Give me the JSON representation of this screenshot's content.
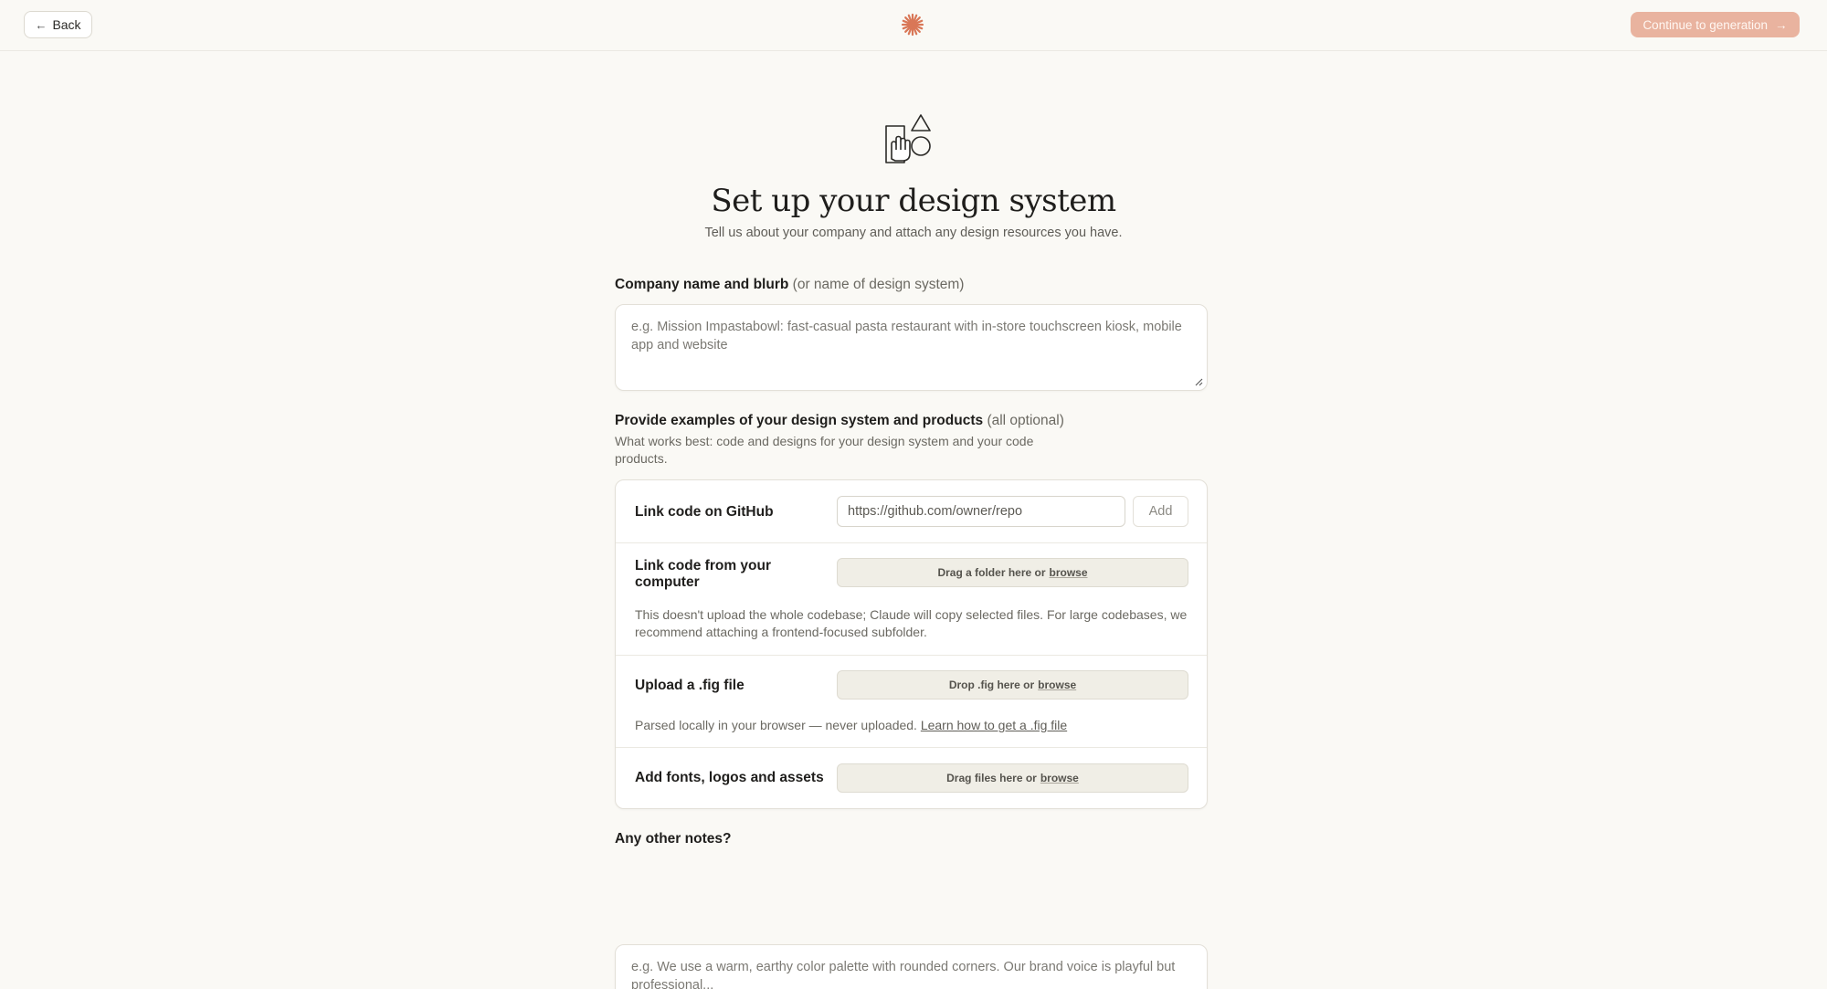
{
  "topbar": {
    "back_label": "Back",
    "back_icon": "arrow-left-icon",
    "logo_icon": "asterisk-logo-icon",
    "continue_label": "Continue to generation",
    "continue_icon": "arrow-right-icon",
    "continue_color": "#e9b39f"
  },
  "hero": {
    "icon": "shapes-hand-icon",
    "title": "Set up your design system",
    "subtitle": "Tell us about your company and attach any design resources you have."
  },
  "company": {
    "label": "Company name and blurb",
    "label_muted": "(or name of design system)",
    "placeholder": "e.g. Mission Impastabowl: fast-casual pasta restaurant with in-store touchscreen kiosk, mobile app and website"
  },
  "examples": {
    "label": "Provide examples of your design system and products",
    "label_muted": "(all optional)",
    "hint_line1": "What works best: code and designs for your design system and your code",
    "hint_line2": "products.",
    "github": {
      "label": "Link code on GitHub",
      "placeholder": "https://github.com/owner/repo",
      "add_label": "Add"
    },
    "local": {
      "label_line1": "Link code from your",
      "label_line2": "computer",
      "drop_text": "Drag a folder here or",
      "browse": "browse",
      "note_line1": "This doesn't upload the whole codebase; Claude will copy selected files. For large codebases, we",
      "note_line2": "recommend attaching a frontend-focused subfolder."
    },
    "fig": {
      "label": "Upload a .fig file",
      "drop_text": "Drop .fig here or",
      "browse": "browse",
      "note": "Parsed locally in your browser — never uploaded.",
      "note_link": "Learn how to get a .fig file"
    },
    "assets": {
      "label": "Add fonts, logos and assets",
      "drop_text": "Drag files here or",
      "browse": "browse"
    }
  },
  "notes": {
    "label": "Any other notes?",
    "placeholder": "e.g. We use a warm, earthy color palette with rounded corners. Our brand voice is playful but professional..."
  },
  "colors": {
    "background": "#faf9f5",
    "accent_logo": "#d97757"
  }
}
